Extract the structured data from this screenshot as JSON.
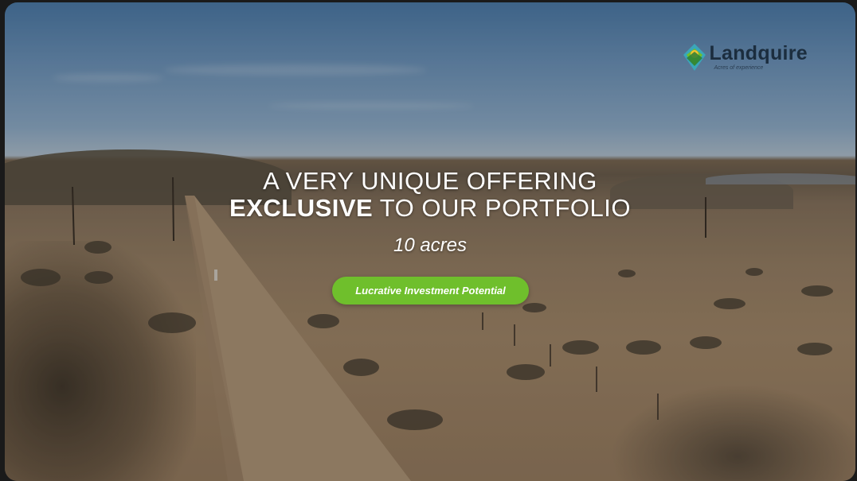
{
  "brand": {
    "name": "Landquire",
    "tagline": "Acres of experience",
    "logo_icon": "landquire-logo-icon",
    "colors": {
      "green": "#6fbf2c",
      "navy": "#1b2d3e",
      "teal": "#3aa6b9",
      "yellow": "#f2c230"
    }
  },
  "hero": {
    "headline_line1": "A VERY UNIQUE OFFERING",
    "headline_line2_bold": "EXCLUSIVE",
    "headline_line2_rest": " TO OUR PORTFOLIO",
    "acreage": "10 acres",
    "cta_label": "Lucrative Investment Potential"
  }
}
